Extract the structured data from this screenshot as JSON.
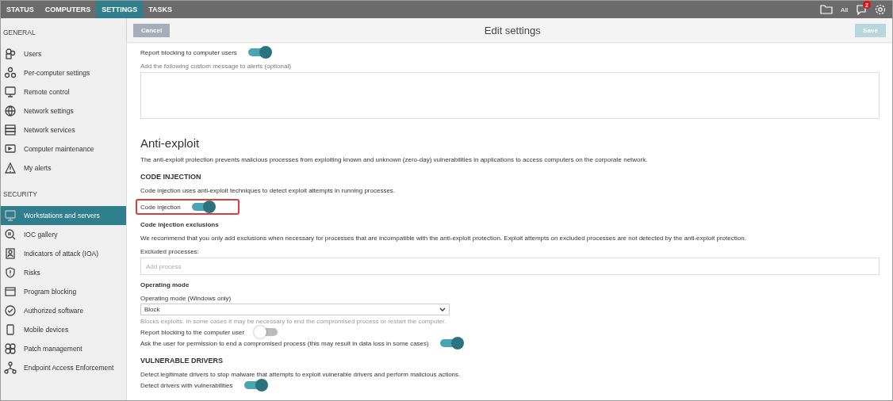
{
  "top_tabs": [
    {
      "label": "STATUS",
      "selected": false
    },
    {
      "label": "COMPUTERS",
      "selected": false
    },
    {
      "label": "SETTINGS",
      "selected": true
    },
    {
      "label": "TASKS",
      "selected": false
    }
  ],
  "top_tools": {
    "folder_label": "All",
    "notification_count": "2"
  },
  "sidebar": {
    "groups": [
      {
        "title": "GENERAL",
        "items": [
          {
            "label": "Users",
            "selected": false
          },
          {
            "label": "Per-computer settings",
            "selected": false
          },
          {
            "label": "Remote control",
            "selected": false
          },
          {
            "label": "Network settings",
            "selected": false
          },
          {
            "label": "Network services",
            "selected": false
          },
          {
            "label": "Computer maintenance",
            "selected": false
          },
          {
            "label": "My alerts",
            "selected": false
          }
        ]
      },
      {
        "title": "SECURITY",
        "items": [
          {
            "label": "Workstations and servers",
            "selected": true
          },
          {
            "label": "IOC gallery",
            "selected": false
          },
          {
            "label": "Indicators of attack (IOA)",
            "selected": false
          },
          {
            "label": "Risks",
            "selected": false
          },
          {
            "label": "Program blocking",
            "selected": false
          },
          {
            "label": "Authorized software",
            "selected": false
          },
          {
            "label": "Mobile devices",
            "selected": false
          },
          {
            "label": "Patch management",
            "selected": false
          },
          {
            "label": "Endpoint Access Enforcement",
            "selected": false
          }
        ]
      }
    ]
  },
  "header": {
    "cancel": {
      "label": "Cancel",
      "disabled": false
    },
    "title": "Edit settings",
    "save": {
      "label": "Save",
      "disabled": true
    }
  },
  "content": [
    {
      "kind": "toggle",
      "label": "Report blocking to computer users",
      "on": true,
      "highlighted": false
    },
    {
      "kind": "label",
      "text": "Add the following custom message to alerts (optional)"
    },
    {
      "kind": "textarea"
    },
    {
      "kind": "heading",
      "text": "Anti-exploit"
    },
    {
      "kind": "paragraph",
      "text": "The anti-exploit protection prevents malicious processes from exploiting known and unknown (zero-day) vulnerabilities in applications to access computers on the corporate network."
    },
    {
      "kind": "subheading",
      "text": "CODE INJECTION"
    },
    {
      "kind": "paragraph",
      "text": "Code injection uses anti-exploit techniques to detect exploit attempts in running processes."
    },
    {
      "kind": "toggle",
      "label": "Code injection",
      "on": true,
      "highlighted": true
    },
    {
      "kind": "bold_label",
      "text": "Code injection exclusions"
    },
    {
      "kind": "paragraph",
      "text": "We recommend that you only add exclusions when necessary for processes that are incompatible with the anti-exploit protection. Exploit attempts on excluded processes are not detected by the anti-exploit protection."
    },
    {
      "kind": "label",
      "text": "Excluded processes:"
    },
    {
      "kind": "input",
      "placeholder": "Add process"
    },
    {
      "kind": "bold_label",
      "text": "Operating mode"
    },
    {
      "kind": "label",
      "text": "Operating mode (Windows only)"
    },
    {
      "kind": "select",
      "value": "Block"
    },
    {
      "kind": "hint",
      "text": "Blocks exploits. In some cases it may be necessary to end the compromised process or restart the computer."
    },
    {
      "kind": "toggle",
      "label": "Report blocking to the computer user",
      "on": false,
      "highlighted": false
    },
    {
      "kind": "toggle",
      "label": "Ask the user for permission to end a compromised process (this may result in data loss in some cases)",
      "on": true,
      "highlighted": false
    },
    {
      "kind": "subheading",
      "text": "VULNERABLE DRIVERS"
    },
    {
      "kind": "paragraph",
      "text": "Detect legitimate drivers to stop malware that attempts to exploit vulnerable drivers and perform malicious actions."
    },
    {
      "kind": "toggle",
      "label": "Detect drivers with vulnerabilities",
      "on": true,
      "highlighted": false
    }
  ]
}
